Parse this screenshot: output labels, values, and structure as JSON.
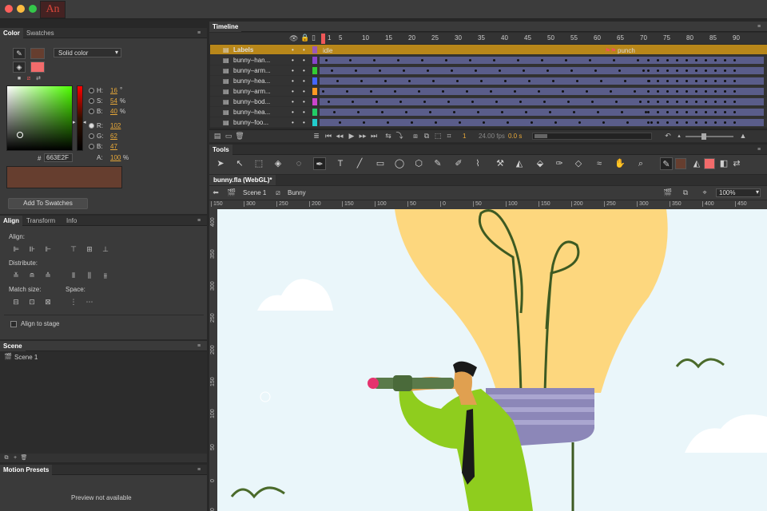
{
  "app": {
    "logo": "An"
  },
  "color_panel": {
    "tabs": [
      "Color",
      "Swatches"
    ],
    "fill_type": "Solid color",
    "hsb": {
      "h_label": "H:",
      "h": "16",
      "h_unit": "°",
      "s_label": "S:",
      "s": "54",
      "s_unit": "%",
      "b_label": "B:",
      "b": "40",
      "b_unit": "%"
    },
    "rgb": {
      "r_label": "R:",
      "r": "102",
      "g_label": "G:",
      "g": "62",
      "b_label": "B:",
      "b": "47"
    },
    "alpha_label": "A:",
    "alpha": "100",
    "alpha_unit": "%",
    "hex_prefix": "#",
    "hex": "663E2F",
    "swatch_color": "#663e2f",
    "add_button": "Add To Swatches"
  },
  "align_panel": {
    "tabs": [
      "Align",
      "Transform",
      "Info"
    ],
    "align_label": "Align:",
    "distribute_label": "Distribute:",
    "match_label": "Match size:",
    "space_label": "Space:",
    "stage_label": "Align to stage"
  },
  "scene_panel": {
    "title": "Scene",
    "item": "Scene 1"
  },
  "presets_panel": {
    "title": "Motion Presets",
    "message": "Preview not available"
  },
  "timeline": {
    "title": "Timeline",
    "frames": [
      "1",
      "5",
      "10",
      "15",
      "20",
      "25",
      "30",
      "35",
      "40",
      "45",
      "50",
      "55",
      "60",
      "65",
      "70",
      "75",
      "80",
      "85",
      "90"
    ],
    "layers": [
      {
        "name": "Labels",
        "color": "#9b59b6"
      },
      {
        "name": "bunny–han...",
        "color": "#8844cc"
      },
      {
        "name": "bunny–arm...",
        "color": "#33cc33"
      },
      {
        "name": "bunny–hea...",
        "color": "#4466ff"
      },
      {
        "name": "bunny–arm...",
        "color": "#ff9922"
      },
      {
        "name": "bunny–bod...",
        "color": "#cc44cc"
      },
      {
        "name": "bunny–hea...",
        "color": "#22cc66"
      },
      {
        "name": "bunny–foo...",
        "color": "#22cccc"
      }
    ],
    "label_idle": "idle",
    "label_punch": "punch",
    "current_frame": "1",
    "fps": "24.00 fps",
    "time": "0.0 s"
  },
  "tools": {
    "title": "Tools"
  },
  "document": {
    "tab": "bunny.fla (WebGL)*",
    "scene": "Scene 1",
    "symbol": "Bunny",
    "zoom": "100%"
  },
  "ruler": {
    "h": [
      "150",
      "300",
      "250",
      "200",
      "150",
      "100",
      "50",
      "0",
      "50",
      "100",
      "150",
      "200",
      "250",
      "300",
      "350",
      "400",
      "450"
    ],
    "v": [
      "400",
      "350",
      "300",
      "250",
      "200",
      "150",
      "100",
      "50",
      "0",
      "50"
    ]
  },
  "colors": {
    "stage": "#eaf6fa",
    "bulb": "#fdd77e",
    "basket": "#8c87b8",
    "shirt": "#8fcd1e",
    "accent": "#e8a838"
  }
}
